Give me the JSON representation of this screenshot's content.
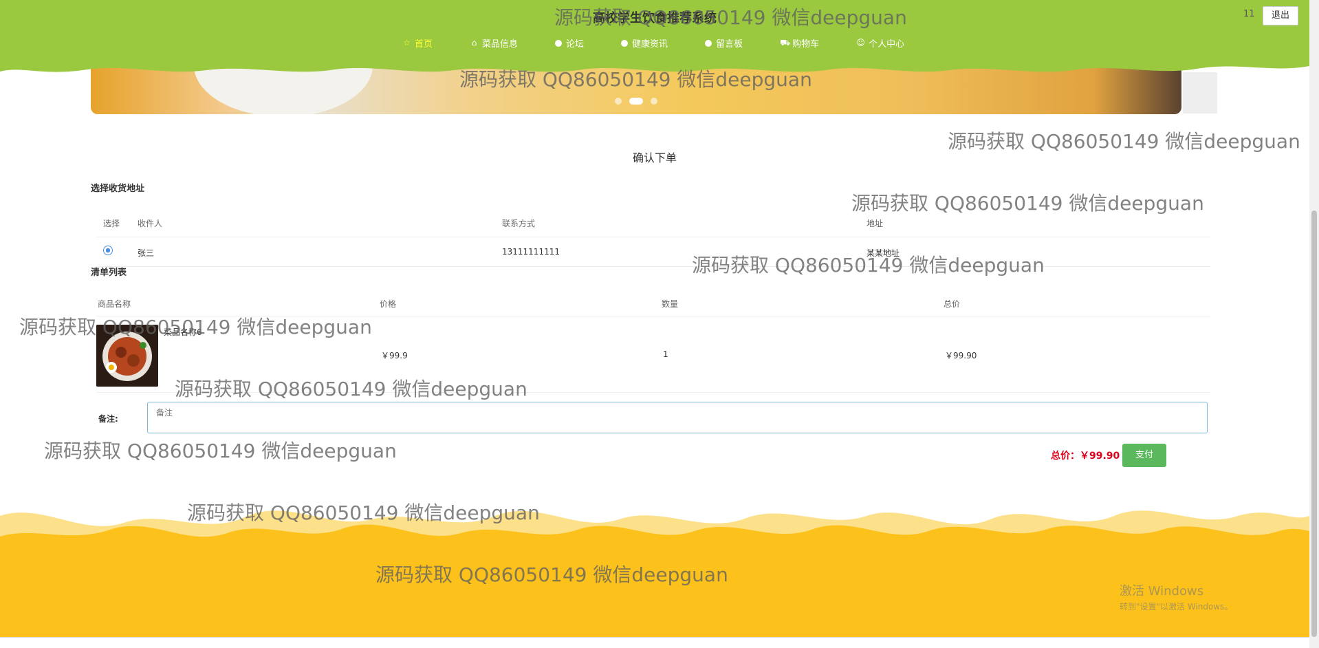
{
  "header": {
    "site_title": "高校学生饮食推荐系统",
    "user_name": "11",
    "logout_label": "退出",
    "nav": [
      {
        "label": "首页",
        "icon": "star-icon",
        "active": true
      },
      {
        "label": "菜品信息",
        "icon": "bag-icon",
        "active": false
      },
      {
        "label": "论坛",
        "icon": "dot-icon",
        "active": false
      },
      {
        "label": "健康资讯",
        "icon": "dot-icon",
        "active": false
      },
      {
        "label": "留言板",
        "icon": "dot-icon",
        "active": false
      },
      {
        "label": "购物车",
        "icon": "cart-icon",
        "active": false
      },
      {
        "label": "个人中心",
        "icon": "user-icon",
        "active": false
      }
    ],
    "colors": {
      "header_bg": "#9ac83f",
      "active_nav": "#ffff33"
    }
  },
  "banner": {
    "slides": 3,
    "active_slide": 2
  },
  "order": {
    "title": "确认下单",
    "address_section_title": "选择收货地址",
    "address_headers": {
      "select": "选择",
      "receiver": "收件人",
      "contact": "联系方式",
      "address": "地址"
    },
    "addresses": [
      {
        "receiver": "张三",
        "contact": "13111111111",
        "address": "某某地址",
        "selected": true
      }
    ],
    "list_section_title": "清单列表",
    "goods_headers": {
      "name": "商品名称",
      "price": "价格",
      "quantity": "数量",
      "total": "总价"
    },
    "goods": [
      {
        "name": "菜品名称6",
        "price": "￥99.9",
        "quantity": "1",
        "total": "￥99.90"
      }
    ],
    "remark_label": "备注:",
    "remark_placeholder": "备注",
    "total_label": "总价：￥99.90",
    "pay_label": "支付"
  },
  "footer": {
    "colors": {
      "wave_light": "#fce08a",
      "wave_main": "#fcc21b"
    }
  },
  "system": {
    "activate_title": "激活 Windows",
    "activate_sub": "转到\"设置\"以激活 Windows。"
  },
  "watermark_text": "源码获取 QQ86050149 微信deepguan"
}
